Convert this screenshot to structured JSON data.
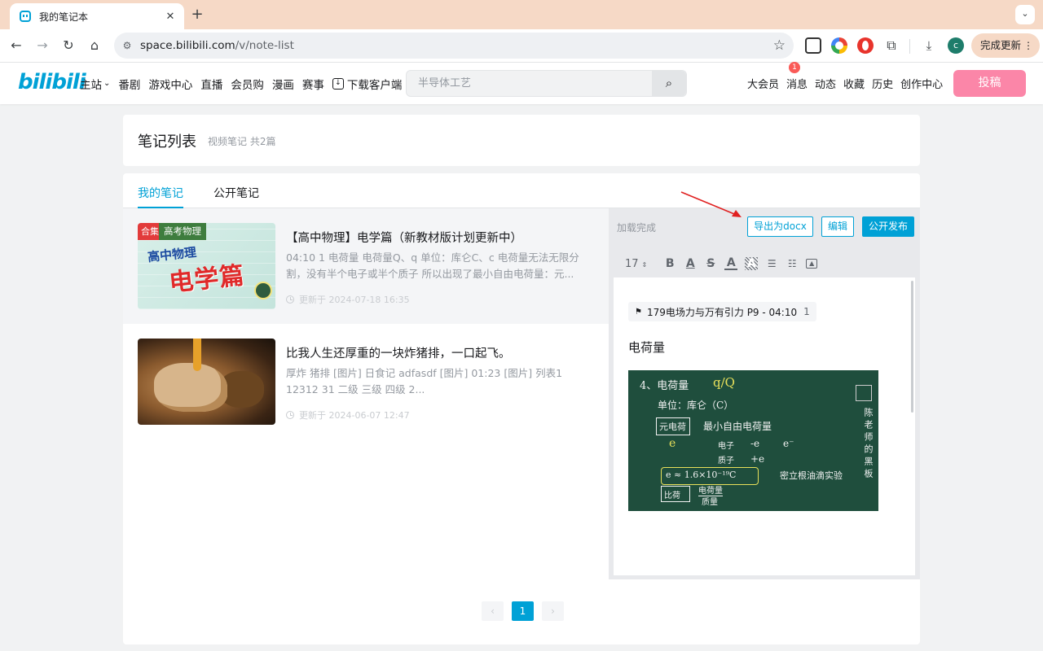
{
  "browser": {
    "tab_title": "我的笔记本",
    "new_tab": "+",
    "url_host": "space.bilibili.com",
    "url_path": "/v/note-list",
    "profile_initial": "c",
    "update_button": "完成更新"
  },
  "header": {
    "logo": "bilibili",
    "nav_left": [
      "主站",
      "番剧",
      "游戏中心",
      "直播",
      "会员购",
      "漫画",
      "赛事",
      "下载客户端"
    ],
    "search_placeholder": "半导体工艺",
    "nav_right": [
      "大会员",
      "消息",
      "动态",
      "收藏",
      "历史",
      "创作中心"
    ],
    "message_badge": "1",
    "upload_button": "投稿"
  },
  "page": {
    "title": "笔记列表",
    "subtitle": "视频笔记 共2篇",
    "tabs": [
      "我的笔记",
      "公开笔记"
    ],
    "active_tab": "我的笔记"
  },
  "notes": [
    {
      "title": "【高中物理】电学篇（新教材版计划更新中）",
      "desc": "04:10 1 电荷量 电荷量Q、q 单位：库仑C、c 电荷量无法无限分割，没有半个电子或半个质子 所以出现了最小自由电荷量：元...",
      "time": "更新于 2024-07-18 16:35",
      "thumb_tag_1": "合集",
      "thumb_tag_2": "高考物理",
      "thumb_line_1": "高中物理",
      "thumb_line_2": "电学篇",
      "selected": true
    },
    {
      "title": "比我人生还厚重的一块炸猪排，一口起飞。",
      "desc": "厚炸 猪排 [图片] 日食记 adfasdf [图片] 01:23 [图片] 列表1 12312 31 二级 三级 四级 2...",
      "time": "更新于 2024-06-07 12:47",
      "selected": false
    }
  ],
  "detail": {
    "status": "加载完成",
    "export_button": "导出为docx",
    "edit_button": "编辑",
    "publish_button": "公开发布",
    "font_size": "17",
    "toolbar_icons": [
      "bold-icon",
      "underline-icon",
      "strikethrough-icon",
      "font-color-icon",
      "background-color-icon",
      "ordered-list-icon",
      "unordered-list-icon",
      "image-icon"
    ],
    "timestamp_label": "179电场力与万有引力 P9 - 04:10",
    "timestamp_num": "1",
    "note_heading": "电荷量",
    "board_text": {
      "l1": "4、电荷量",
      "l1y": "q/Q",
      "l2": "单位：库仑（C）",
      "l3a": "元电荷",
      "l3b": "最小自由电荷量",
      "l4": "e",
      "l4b": "电子",
      "l4c": "-e",
      "l4d": "e⁻",
      "l5": "质子",
      "l5b": "+e",
      "l6": "e ≈ 1.6×10⁻¹⁹C",
      "l6b": "密立根油滴实验",
      "l7a": "比荷",
      "l7b": "电荷量",
      "l7c": "质量",
      "side": "陈老师的黑板"
    }
  },
  "pagination": {
    "prev": "‹",
    "current": "1",
    "next": "›"
  },
  "colors": {
    "brand_blue": "#00a1d6",
    "brand_pink": "#fb7299",
    "annotation_arrow": "#e02020"
  }
}
